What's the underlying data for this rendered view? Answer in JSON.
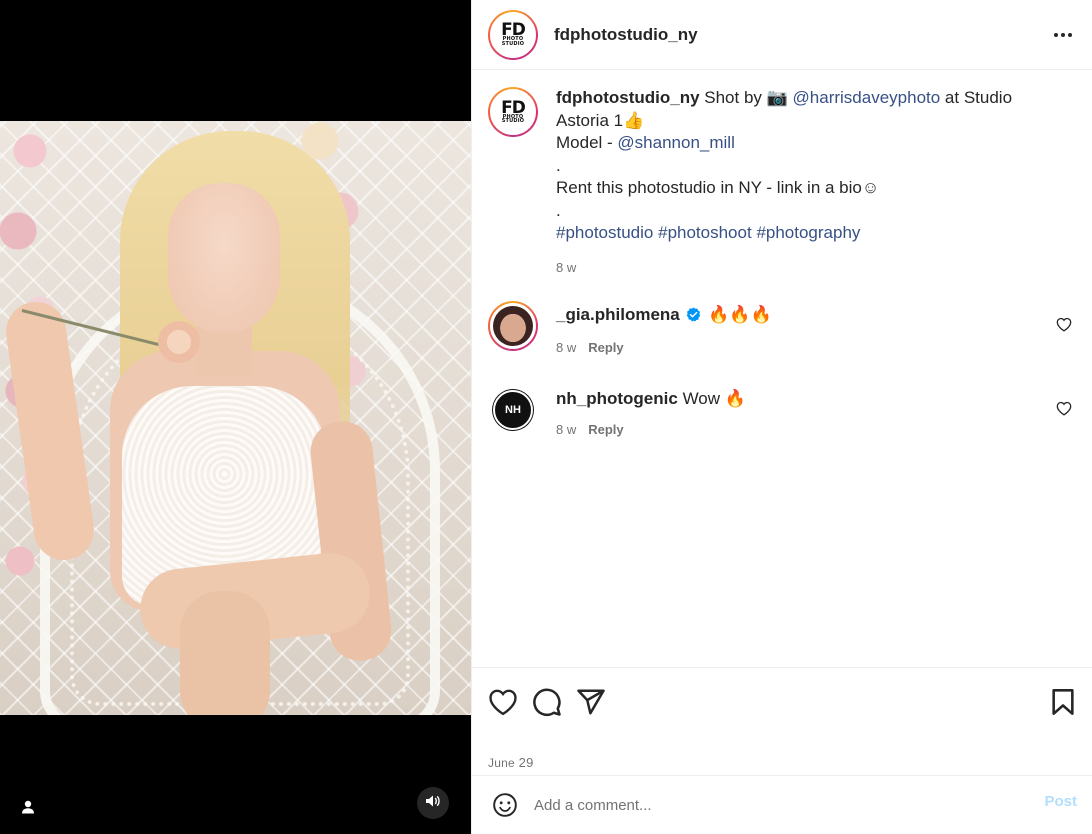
{
  "post": {
    "owner": "fdphotostudio_ny",
    "logo_fd": "FD",
    "logo_photo": "PHOTO",
    "logo_studio": "STUDIO",
    "more_icon": "more-horizontal-icon"
  },
  "caption": {
    "username": "fdphotostudio_ny",
    "text_shot_by": " Shot by 📷 ",
    "mention_photographer": "@harrisdaveyphoto",
    "text_at": " at Studio Astoria 1👍",
    "model_label": "Model - ",
    "mention_model": "@shannon_mill",
    "dot1": ".",
    "rent_line": "Rent this photostudio in NY - link in a bio☺",
    "dot2": ".",
    "hashtags": [
      "#photostudio",
      "#photoshoot",
      "#photography"
    ],
    "time": "8 w"
  },
  "comments": [
    {
      "username": "_gia.philomena",
      "verified": true,
      "text": "🔥🔥🔥",
      "time": "8 w",
      "reply_label": "Reply"
    },
    {
      "username": "nh_photogenic",
      "verified": false,
      "text": "Wow 🔥",
      "time": "8 w",
      "reply_label": "Reply",
      "avatar_text": "NH"
    }
  ],
  "actions": {
    "like_icon": "heart-icon",
    "comment_icon": "comment-icon",
    "share_icon": "send-icon",
    "save_icon": "bookmark-icon",
    "date_month": "June",
    "date_day": " 29"
  },
  "add_comment": {
    "placeholder": "Add a comment...",
    "post_label": "Post"
  },
  "colors": {
    "link": "#385185",
    "verified": "#0095f6",
    "post_disabled": "#b2dffc"
  }
}
